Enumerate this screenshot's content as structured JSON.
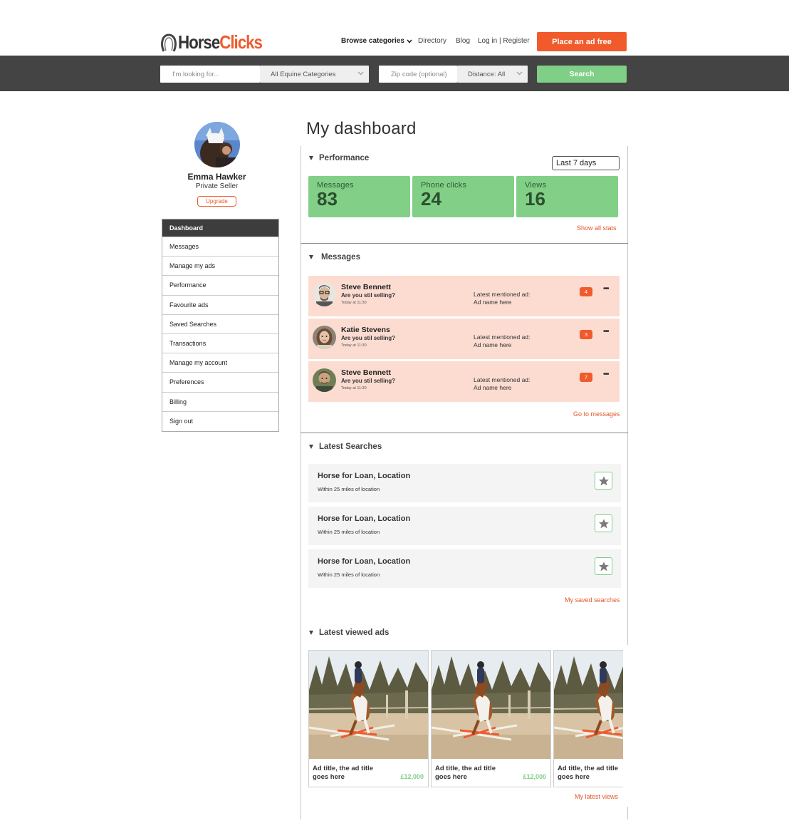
{
  "header": {
    "logo_part1": "Horse",
    "logo_part2": "Clicks",
    "browse_label": "Browse categories",
    "directory_label": "Directory",
    "blog_label": "Blog",
    "login_label": "Log in | Register",
    "place_ad_label": "Place an ad free"
  },
  "search": {
    "keyword_placeholder": "I'm looking for...",
    "category_value": "All Equine Categories",
    "zip_placeholder": "Zip code (optional)",
    "distance_value": "Distance: All",
    "search_label": "Search"
  },
  "profile": {
    "name": "Emma Hawker",
    "role": "Private Seller",
    "upgrade_label": "Upgrade"
  },
  "sidebar": {
    "items": [
      {
        "label": "Dashboard",
        "active": true
      },
      {
        "label": "Messages"
      },
      {
        "label": "Manage my ads"
      },
      {
        "label": "Performance"
      },
      {
        "label": "Favourite ads"
      },
      {
        "label": "Saved Searches"
      },
      {
        "label": "Transactions"
      },
      {
        "label": "Manage my account"
      },
      {
        "label": "Preferences"
      },
      {
        "label": "Billing"
      },
      {
        "label": "Sign out"
      }
    ]
  },
  "main": {
    "title": "My dashboard",
    "performance": {
      "title": "Performance",
      "range": "Last 7 days",
      "stats": [
        {
          "label": "Messages",
          "value": "83"
        },
        {
          "label": "Phone clicks",
          "value": "24"
        },
        {
          "label": "Views",
          "value": "16"
        }
      ],
      "link": "Show all stats"
    },
    "messages": {
      "title": "Messages",
      "items": [
        {
          "name": "Steve Bennett",
          "text": "Are you stil selling?",
          "time": "Today at 11:30",
          "ad_label": "Latest mentioned ad:",
          "ad_name": "Ad name here",
          "count": "4"
        },
        {
          "name": "Katie Stevens",
          "text": "Are you stil selling?",
          "time": "Today at 11:30",
          "ad_label": "Latest mentioned ad:",
          "ad_name": "Ad name here",
          "count": "3"
        },
        {
          "name": "Steve Bennett",
          "text": "Are you stil selling?",
          "time": "Today at 11:30",
          "ad_label": "Latest mentioned ad:",
          "ad_name": "Ad name here",
          "count": "7"
        }
      ],
      "link": "Go to messages"
    },
    "searches": {
      "title": "Latest Searches",
      "items": [
        {
          "title": "Horse for Loan, Location",
          "sub": "Within 25 miles of location"
        },
        {
          "title": "Horse for Loan, Location",
          "sub": "Within 25 miles of location"
        },
        {
          "title": "Horse for Loan, Location",
          "sub": "Within 25 miles of location"
        }
      ],
      "link": "My saved searches"
    },
    "viewed": {
      "title": "Latest viewed ads",
      "items": [
        {
          "title_line1": "Ad title, the ad title",
          "title_line2": "goes here",
          "price": "£12,000"
        },
        {
          "title_line1": "Ad title, the ad title",
          "title_line2": "goes here",
          "price": "£12,000"
        },
        {
          "title_line1": "Ad title, the ad title",
          "title_line2": "goes here",
          "price": ""
        }
      ],
      "link": "My latest views"
    }
  },
  "colors": {
    "brand_orange": "#f15a2b",
    "success_green": "#82cf87",
    "header_band": "#444444",
    "message_bg": "#fcdcd1"
  }
}
